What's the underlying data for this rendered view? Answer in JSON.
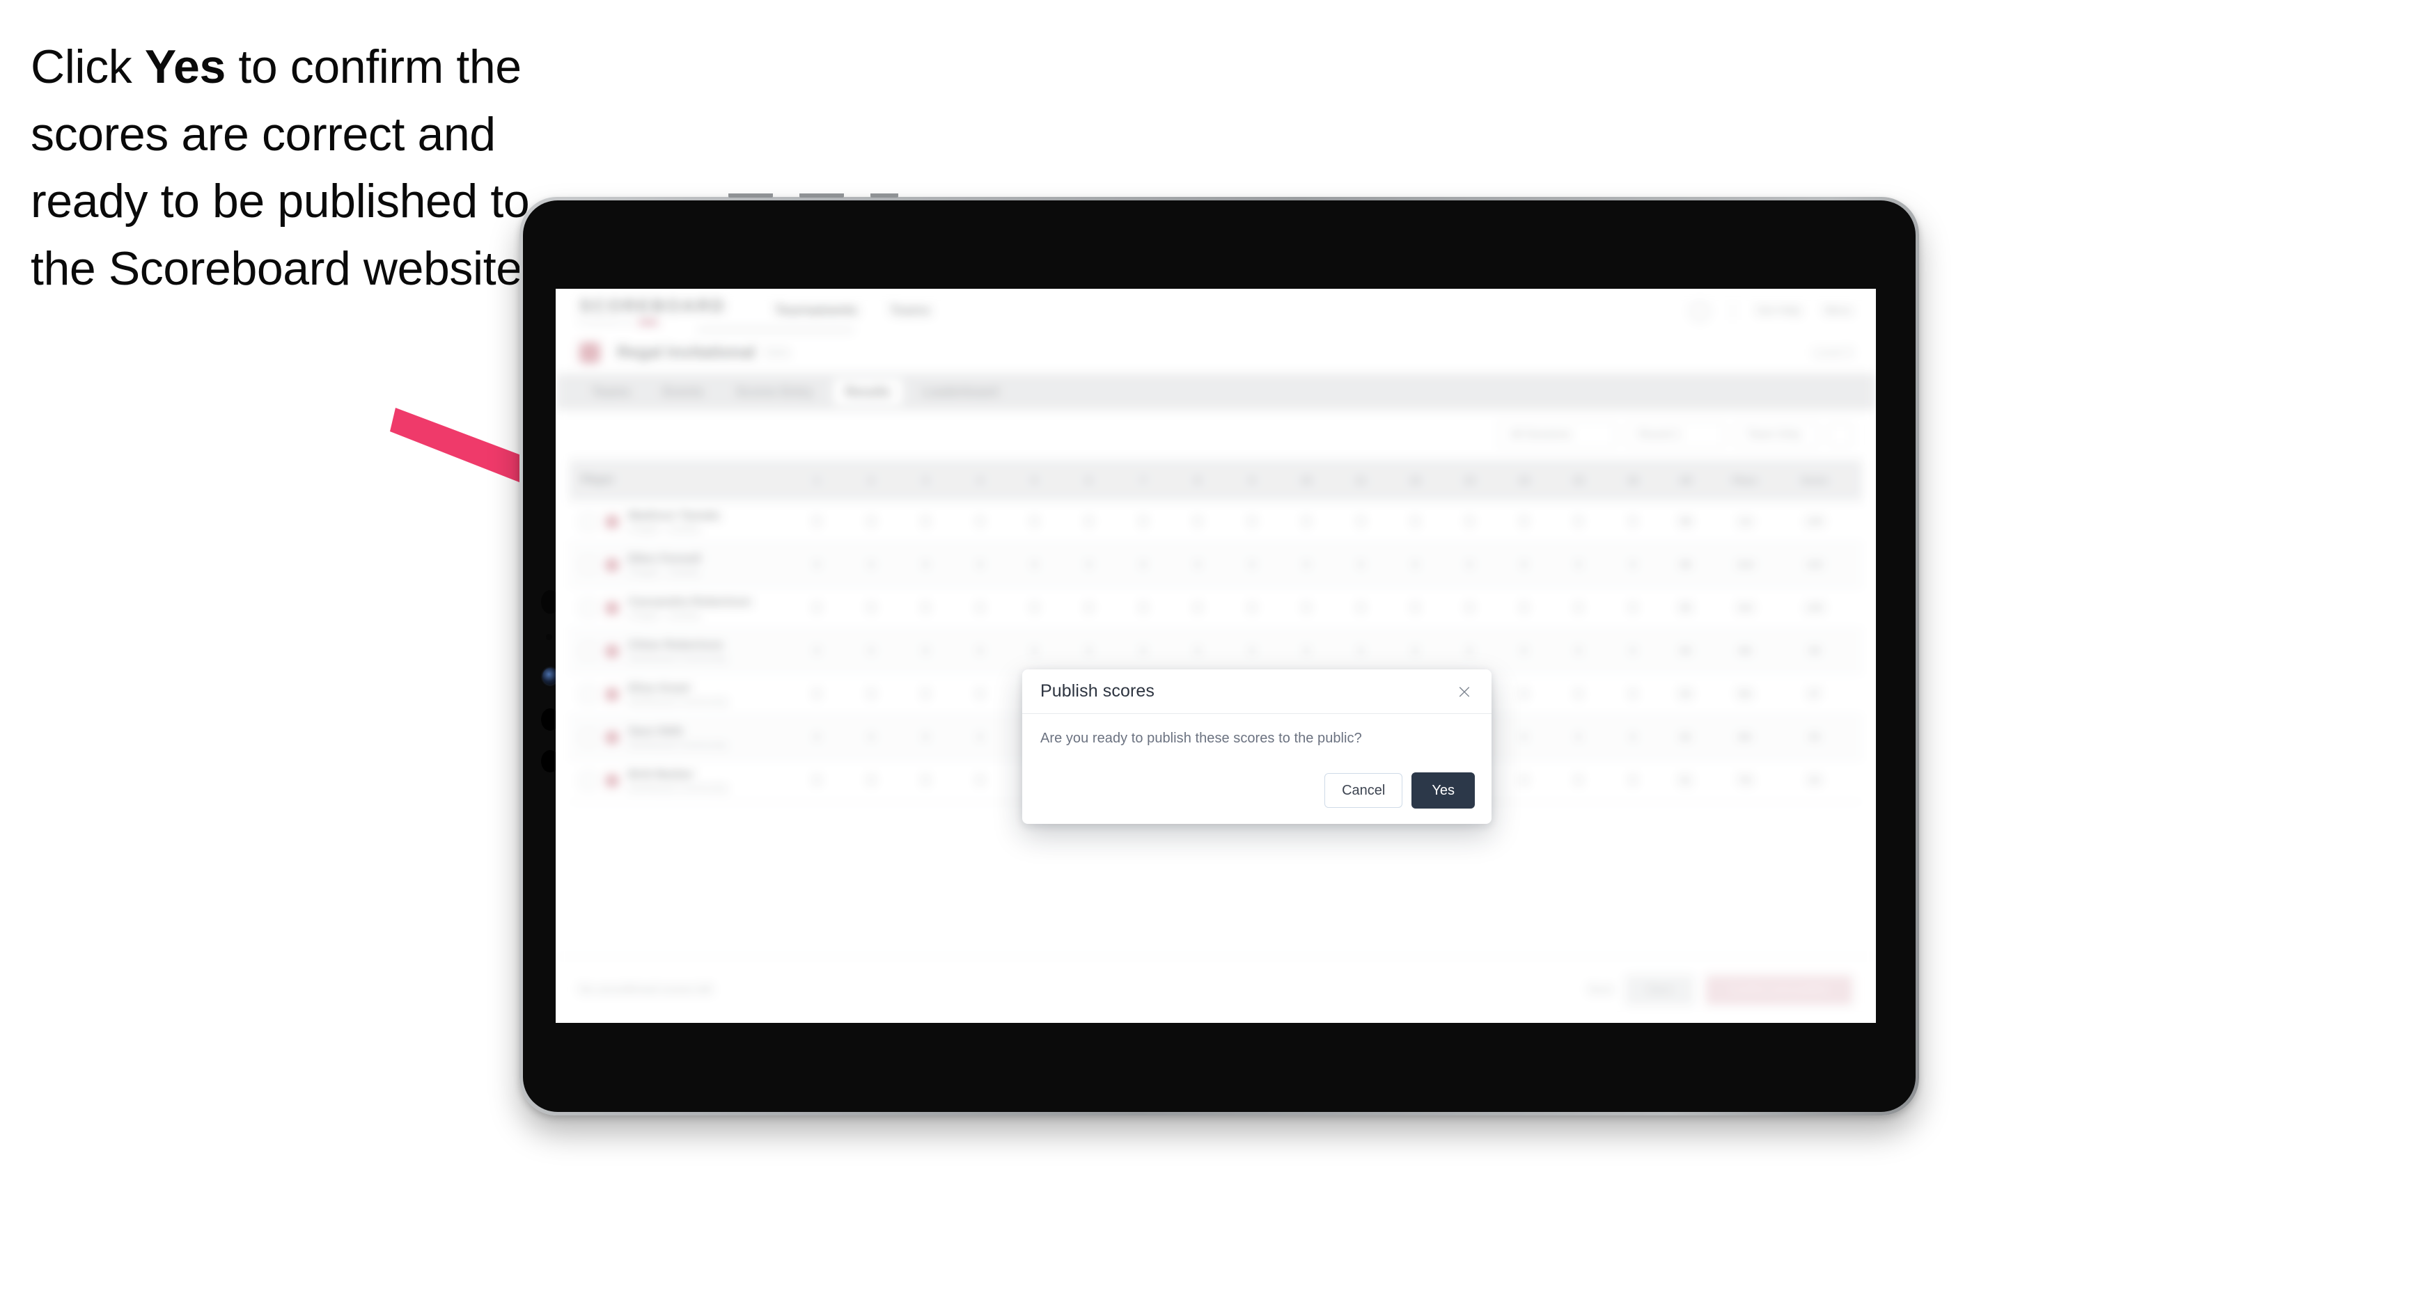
{
  "callout": {
    "line_before": "Click ",
    "emphasis": "Yes",
    "line_after": " to confirm the scores are correct and ready to be published to the Scoreboard website.",
    "arrow_color": "#ef3a6a"
  },
  "device": {
    "type": "tablet",
    "frame_color": "#9a9da0",
    "screen_bg": "#ffffff"
  },
  "app": {
    "brand": "SCOREBOARD",
    "brand_sub": "POWERED BY",
    "nav": [
      {
        "label": "Tournaments"
      },
      {
        "label": "Teams"
      }
    ],
    "topright": [
      {
        "label": "Get Help"
      },
      {
        "label": "Menu"
      }
    ],
    "title": {
      "name": "Regal Invitational",
      "sub": "Girls",
      "right": "Level 3"
    },
    "tabs": [
      {
        "label": "Teams",
        "selected": false
      },
      {
        "label": "Events",
        "selected": false
      },
      {
        "label": "Scores Entry",
        "selected": false
      },
      {
        "label": "Results",
        "selected": true
      },
      {
        "label": "Leaderboard",
        "selected": false
      }
    ],
    "filters": [
      {
        "label": "All Sessions"
      },
      {
        "label": "Round 1"
      },
      {
        "label": "Team Only"
      }
    ],
    "table": {
      "header_player": "Player",
      "header_numbers": [
        "1",
        "2",
        "3",
        "4",
        "5",
        "6",
        "7",
        "8",
        "9",
        "10",
        "11",
        "12",
        "13",
        "14",
        "15",
        "16"
      ],
      "header_tail": [
        "All",
        "Place",
        "Score"
      ],
      "rows": [
        {
          "name": "Madison Tamala",
          "team": "Chapel - Central",
          "nums": [
            "9",
            "9",
            "9",
            "9",
            "9",
            "9",
            "9",
            "9",
            "9",
            "9",
            "9",
            "9",
            "9",
            "9",
            "9",
            "9"
          ],
          "tail": [
            "88",
            "1st",
            "105"
          ]
        },
        {
          "name": "Ellen Fennell",
          "team": "Chapel - Central",
          "nums": [
            "9",
            "9",
            "9",
            "9",
            "9",
            "9",
            "9",
            "9",
            "9",
            "9",
            "9",
            "9",
            "9",
            "9",
            "9",
            "9"
          ],
          "tail": [
            "86",
            "2nd",
            "102"
          ]
        },
        {
          "name": "Cassandra Robertson",
          "team": "Chapel - Central",
          "nums": [
            "9",
            "9",
            "9",
            "9",
            "9",
            "9",
            "9",
            "9",
            "9",
            "9",
            "9",
            "9",
            "9",
            "9",
            "9",
            "9"
          ],
          "tail": [
            "85",
            "3rd",
            "100"
          ]
        },
        {
          "name": "Chloe Robertson",
          "team": "Northwood Community",
          "nums": [
            "9",
            "9",
            "9",
            "9",
            "9",
            "9",
            "9",
            "9",
            "9",
            "9",
            "9",
            "9",
            "9",
            "9",
            "9",
            "9"
          ],
          "tail": [
            "84",
            "4th",
            "99"
          ]
        },
        {
          "name": "Eliza Grant",
          "team": "Northwood Community",
          "nums": [
            "9",
            "9",
            "9",
            "9",
            "9",
            "9",
            "9",
            "9",
            "9",
            "9",
            "9",
            "9",
            "9",
            "9",
            "9",
            "9"
          ],
          "tail": [
            "83",
            "5th",
            "97"
          ]
        },
        {
          "name": "Sara Stith",
          "team": "Northwood Community",
          "nums": [
            "9",
            "9",
            "9",
            "9",
            "9",
            "9",
            "9",
            "9",
            "9",
            "9",
            "9",
            "9",
            "9",
            "9",
            "9",
            "9"
          ],
          "tail": [
            "82",
            "6th",
            "95"
          ]
        },
        {
          "name": "Britt Barber",
          "team": "Northwood Community",
          "nums": [
            "9",
            "9",
            "9",
            "9",
            "9",
            "9",
            "9",
            "9",
            "9",
            "9",
            "9",
            "9",
            "9",
            "9",
            "9",
            "9"
          ],
          "tail": [
            "81",
            "7th",
            "94"
          ]
        }
      ]
    },
    "footer": {
      "note": "No unconfirmed scores left",
      "link": "Back",
      "secondary_button": "Save",
      "primary_button": "Confirm and publish"
    }
  },
  "modal": {
    "title": "Publish scores",
    "message": "Are you ready to publish these scores to the public?",
    "close_icon": "×",
    "cancel_label": "Cancel",
    "confirm_label": "Yes",
    "confirm_bg": "#2c3849",
    "cancel_border": "#cfdbe8"
  }
}
